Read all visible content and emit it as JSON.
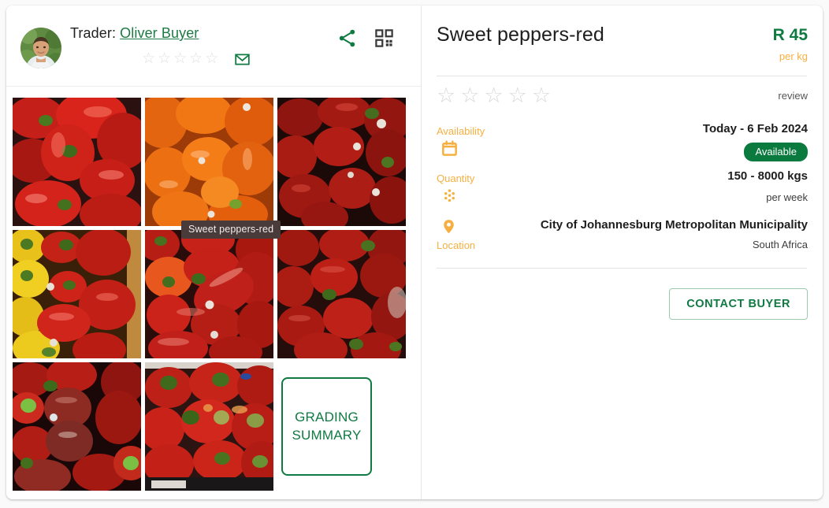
{
  "header": {
    "trader_prefix": "Trader:",
    "trader_name": "Oliver Buyer",
    "avatar_name": "avatar",
    "share_icon": "share-icon",
    "qr_icon": "qr-code-icon",
    "mail_icon": "mail-icon",
    "trader_rating_stars": [
      "☆",
      "☆",
      "☆",
      "☆",
      "☆"
    ]
  },
  "gallery": {
    "tooltip": "Sweet peppers-red",
    "grading_summary_line1": "GRADING",
    "grading_summary_line2": "SUMMARY",
    "thumbs": [
      {
        "name": "thumb-red-peppers-1"
      },
      {
        "name": "thumb-orange-peppers"
      },
      {
        "name": "thumb-dark-red-peppers-1"
      },
      {
        "name": "thumb-yellow-red-peppers"
      },
      {
        "name": "thumb-red-peppers-2"
      },
      {
        "name": "thumb-dark-red-peppers-2"
      },
      {
        "name": "thumb-red-peppers-3"
      },
      {
        "name": "thumb-red-peppers-4"
      }
    ]
  },
  "product": {
    "title": "Sweet peppers-red",
    "price": "R 45",
    "price_unit": "per kg",
    "review_label": "review",
    "rating_stars": [
      "☆",
      "☆",
      "☆",
      "☆",
      "☆"
    ],
    "details": {
      "availability": {
        "label": "Availability",
        "icon": "calendar-icon",
        "value": "Today - 6 Feb 2024",
        "badge": "Available"
      },
      "quantity": {
        "label": "Quantity",
        "icon": "grain-dots-icon",
        "value": "150 - 8000 kgs",
        "sub": "per week"
      },
      "location": {
        "label": "Location",
        "icon": "map-pin-icon",
        "value": "City of Johannesburg Metropolitan Municipality",
        "sub": "South Africa"
      }
    },
    "contact_button": "CONTACT BUYER"
  },
  "colors": {
    "green": "#0f7a41",
    "orange": "#f5b041",
    "badge_green": "#0b7a3f",
    "text_dark": "#1d1d1d"
  }
}
